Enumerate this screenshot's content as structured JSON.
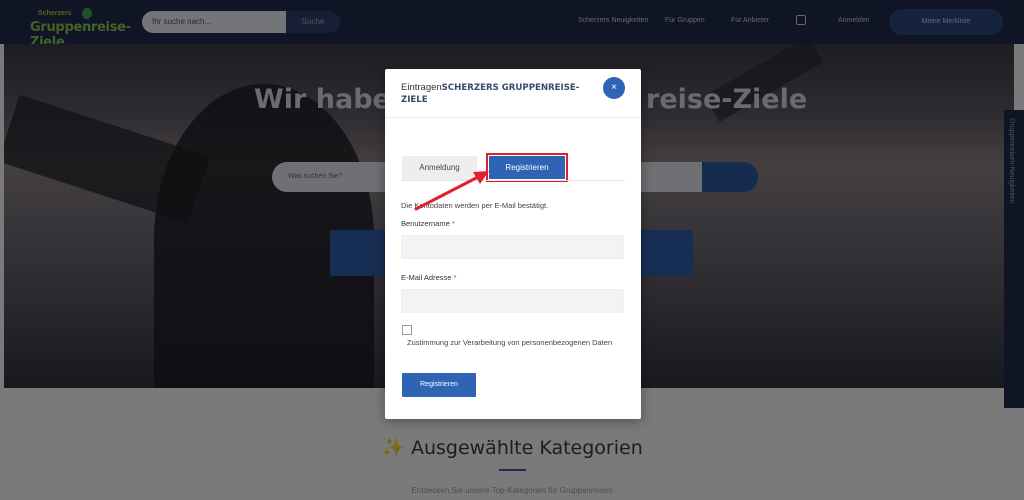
{
  "header": {
    "logo_small": "Scherzers",
    "logo_big": "Gruppenreise-Ziele",
    "search_placeholder": "Ihr suche nach...",
    "search_button": "Suche",
    "nav": {
      "news": "Scherzers Neuigkeiten",
      "for_groups": "Für Gruppen",
      "for_providers": "Für Anbieter",
      "login": "Anmelden"
    },
    "wishlist_button": "Meine Merkliste"
  },
  "hero": {
    "title_left": "Wir haben",
    "title_right": "reise-Ziele",
    "search_placeholder": "Was suchen Sie?"
  },
  "side_tab": "Gruppenreisen-Neuigkeiten",
  "section": {
    "title": "✨ Ausgewählte Kategorien",
    "subtitle": "Entdecken Sie unsere Top-Kategorien für Gruppenreisen"
  },
  "modal": {
    "title_prefix": "Eintragen",
    "title_caps": "SCHERZERS GRUPPENREISE-ZIELE",
    "close_icon": "×",
    "tabs": {
      "login": "Anmeldung",
      "register": "Registrieren"
    },
    "info": "Die Kontodaten werden per E-Mail bestätigt.",
    "username_label": "Benutzername",
    "email_label": "E-Mail Adresse",
    "required_mark": "*",
    "consent": "Zustimmung zur Verarbeitung von personenbezogenen Daten",
    "submit": "Registrieren"
  },
  "colors": {
    "primary": "#2f64b4",
    "highlight": "#e0202a",
    "header_bg": "#1e2b4a"
  }
}
